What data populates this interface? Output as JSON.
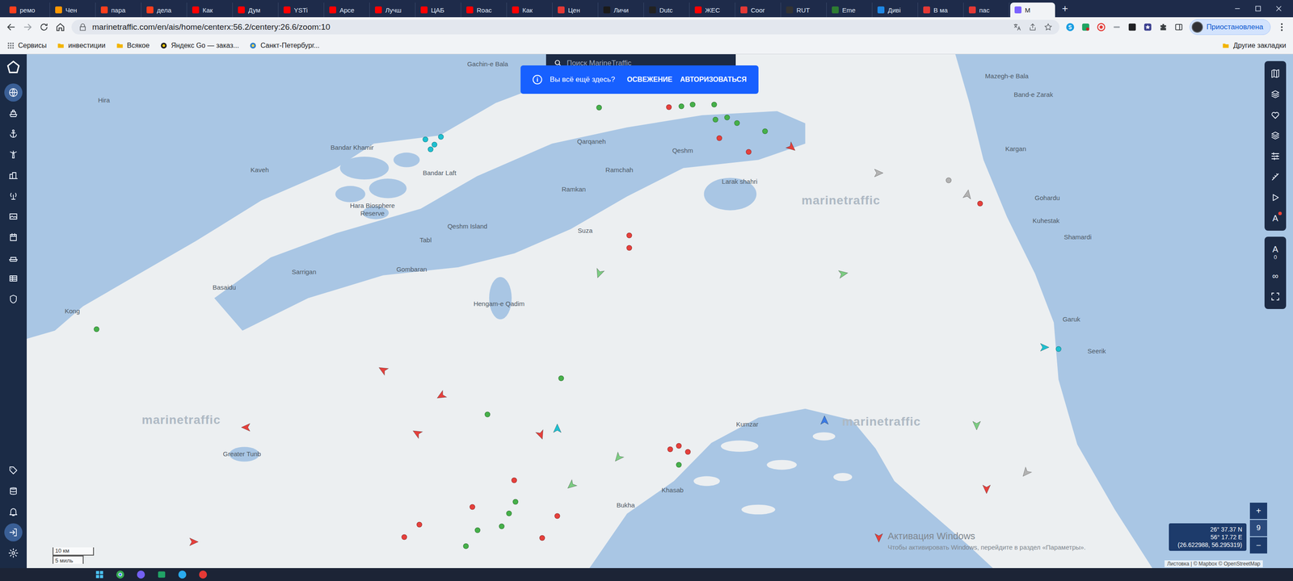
{
  "browser": {
    "tabs": [
      {
        "label": "ремо",
        "selected": false,
        "color": "#fc3f1d"
      },
      {
        "label": "Чен",
        "selected": false,
        "color": "#ff9800"
      },
      {
        "label": "пара",
        "selected": false,
        "color": "#fc3f1d"
      },
      {
        "label": "дела",
        "selected": false,
        "color": "#fc3f1d"
      },
      {
        "label": "Как",
        "selected": false,
        "color": "#ff0000"
      },
      {
        "label": "Дум",
        "selected": false,
        "color": "#ff0000"
      },
      {
        "label": "YSTi",
        "selected": false,
        "color": "#ff0000"
      },
      {
        "label": "Арсе",
        "selected": false,
        "color": "#ff0000"
      },
      {
        "label": "Лучш",
        "selected": false,
        "color": "#ff0000"
      },
      {
        "label": "ЦАБ",
        "selected": false,
        "color": "#ff0000"
      },
      {
        "label": "Roac",
        "selected": false,
        "color": "#ff0000"
      },
      {
        "label": "Как",
        "selected": false,
        "color": "#ff0000"
      },
      {
        "label": "Цен",
        "selected": false,
        "color": "#e53935"
      },
      {
        "label": "Личи",
        "selected": false,
        "color": "#1a1a1a"
      },
      {
        "label": "Dutc",
        "selected": false,
        "color": "#222222"
      },
      {
        "label": "ЖЕС",
        "selected": false,
        "color": "#ff0000"
      },
      {
        "label": "Coor",
        "selected": false,
        "color": "#e53935"
      },
      {
        "label": "RUT",
        "selected": false,
        "color": "#333333"
      },
      {
        "label": "Eme",
        "selected": false,
        "color": "#2e7d32"
      },
      {
        "label": "Диві",
        "selected": false,
        "color": "#1e88e5"
      },
      {
        "label": "В ма",
        "selected": false,
        "color": "#e53935"
      },
      {
        "label": "пас",
        "selected": false,
        "color": "#e53935"
      },
      {
        "label": "M",
        "selected": true,
        "color": "#7b61ff"
      }
    ],
    "new_tab": "+",
    "address": "marinetraffic.com/en/ais/home/centerx:56.2/centery:26.6/zoom:10",
    "profile": "Приостановлена",
    "bookmarks": [
      {
        "label": "Сервисы",
        "kind": "apps"
      },
      {
        "label": "инвестиции",
        "kind": "folder"
      },
      {
        "label": "Всякое",
        "kind": "folder"
      },
      {
        "label": "Яндекс Go — заказ...",
        "kind": "site"
      },
      {
        "label": "Санкт-Петербург...",
        "kind": "site"
      }
    ],
    "other_bookmarks": "Другие закладки"
  },
  "sidebar": {
    "items": [
      {
        "selected": true
      },
      {
        "selected": false
      },
      {
        "selected": false
      },
      {
        "selected": false
      },
      {
        "selected": false
      },
      {
        "selected": false
      },
      {
        "selected": false
      },
      {
        "selected": false
      },
      {
        "selected": false
      },
      {
        "selected": false
      },
      {
        "selected": false
      }
    ],
    "bottom_items": [
      {
        "selected": false
      },
      {
        "selected": false
      },
      {
        "selected": false
      },
      {
        "selected": true
      },
      {
        "selected": false
      }
    ]
  },
  "search": {
    "placeholder": "Поиск MarineTraffic"
  },
  "banner": {
    "icon": "i",
    "message": "Вы всё ещё здесь?",
    "actions": [
      "ОСВЕЖЕНИЕ",
      "АВТОРИЗОВАТЬСЯ"
    ]
  },
  "map": {
    "labels": [
      "Gachin-e Bala",
      "Hira",
      "Bandar Khamir",
      "Kaveh",
      "Bandar Laft",
      "Hara Biosphere Reserve",
      "Qeshm Island",
      "Tabl",
      "Qarqaneh",
      "Qeshm",
      "Ramchah",
      "Ramkan",
      "Larak shahri",
      "Suza",
      "Gombaran",
      "Sarrigan",
      "Basaidu",
      "Kong",
      "Hengam-e Qadim",
      "Greater Tunb",
      "Khasab",
      "Bukha",
      "Kumzar",
      "Mazegh-e Bala",
      "Band-e Zarak",
      "Kargan",
      "Gohardu",
      "Kuhestak",
      "Shamardi",
      "Garuk",
      "Seerik"
    ],
    "watermarks": [
      "marinetraffic",
      "marinetraffic",
      "marinetraffic"
    ],
    "vessels": [
      {
        "kind": "dot",
        "color": "#46b04a"
      },
      {
        "kind": "dot",
        "color": "#46b04a"
      },
      {
        "kind": "dot",
        "color": "#46b04a"
      },
      {
        "kind": "dot",
        "color": "#46b04a"
      },
      {
        "kind": "dot",
        "color": "#46b04a"
      },
      {
        "kind": "dot",
        "color": "#46b04a"
      },
      {
        "kind": "dot",
        "color": "#46b04a"
      },
      {
        "kind": "dot",
        "color": "#46b04a"
      },
      {
        "kind": "dot",
        "color": "#e5403c"
      },
      {
        "kind": "dot",
        "color": "#e5403c"
      },
      {
        "kind": "dot",
        "color": "#e5403c"
      },
      {
        "kind": "dot",
        "color": "#e5403c"
      },
      {
        "kind": "dot",
        "color": "#e5403c"
      },
      {
        "kind": "dot",
        "color": "#1fc0d0"
      },
      {
        "kind": "dot",
        "color": "#1fc0d0"
      },
      {
        "kind": "dot",
        "color": "#1fc0d0"
      },
      {
        "kind": "dot",
        "color": "#1fc0d0"
      },
      {
        "kind": "arrow",
        "color": "#e5403c"
      },
      {
        "kind": "arrow",
        "color": "#b3b3b3"
      },
      {
        "kind": "arrow",
        "color": "#b3b3b3"
      },
      {
        "kind": "arrow",
        "color": "#7ccc82"
      },
      {
        "kind": "arrow",
        "color": "#7ccc82"
      },
      {
        "kind": "arrow",
        "color": "#e5403c"
      },
      {
        "kind": "arrow",
        "color": "#e5403c"
      },
      {
        "kind": "arrow",
        "color": "#e5403c"
      },
      {
        "kind": "arrow",
        "color": "#e5403c"
      },
      {
        "kind": "arrow",
        "color": "#e5403c"
      },
      {
        "kind": "arrow",
        "color": "#3a7be6"
      },
      {
        "kind": "arrow",
        "color": "#7ccc82"
      },
      {
        "kind": "arrow",
        "color": "#7ccc82"
      },
      {
        "kind": "arrow",
        "color": "#7ccc82"
      },
      {
        "kind": "arrow",
        "color": "#1fc0d0"
      },
      {
        "kind": "arrow",
        "color": "#b3b3b3"
      },
      {
        "kind": "arrow",
        "color": "#e5403c"
      },
      {
        "kind": "arrow",
        "color": "#e5403c"
      },
      {
        "kind": "arrow",
        "color": "#e5403c"
      },
      {
        "kind": "dot",
        "color": "#46b04a"
      },
      {
        "kind": "dot",
        "color": "#46b04a"
      },
      {
        "kind": "dot",
        "color": "#e5403c"
      },
      {
        "kind": "dot",
        "color": "#e5403c"
      },
      {
        "kind": "dot",
        "color": "#e5403c"
      },
      {
        "kind": "dot",
        "color": "#e5403c"
      },
      {
        "kind": "dot",
        "color": "#46b04a"
      },
      {
        "kind": "dot",
        "color": "#46b04a"
      },
      {
        "kind": "dot",
        "color": "#46b04a"
      },
      {
        "kind": "dot",
        "color": "#e5403c"
      },
      {
        "kind": "dot",
        "color": "#e5403c"
      },
      {
        "kind": "dot",
        "color": "#e5403c"
      },
      {
        "kind": "dot",
        "color": "#e5403c"
      },
      {
        "kind": "dot",
        "color": "#e5403c"
      },
      {
        "kind": "dot",
        "color": "#46b04a"
      },
      {
        "kind": "dot",
        "color": "#1fc0d0"
      },
      {
        "kind": "dot",
        "color": "#46b04a"
      },
      {
        "kind": "dot",
        "color": "#46b04a"
      },
      {
        "kind": "dot",
        "color": "#46b04a"
      },
      {
        "kind": "arrow",
        "color": "#1fc0d0"
      },
      {
        "kind": "dot",
        "color": "#e5403c"
      },
      {
        "kind": "dot",
        "color": "#b3b3b3"
      }
    ]
  },
  "right_toolbar": {
    "badge_tool": "A",
    "counter": {
      "label": "A",
      "value": "0"
    },
    "loop": "∞"
  },
  "scale": [
    "10 км",
    "5 миль"
  ],
  "coordinates": {
    "lat": "26° 37.37 N",
    "lon": "56° 17.72 E",
    "decimal": "(26.622988, 56.295319)"
  },
  "zoom": {
    "in": "+",
    "level": "9",
    "out": "−"
  },
  "attribution": "Листовка | © Mapbox © OpenStreetMap",
  "windows_watermark": {
    "title": "Активация Windows",
    "text": "Чтобы активировать Windows, перейдите в раздел «Параметры»."
  }
}
